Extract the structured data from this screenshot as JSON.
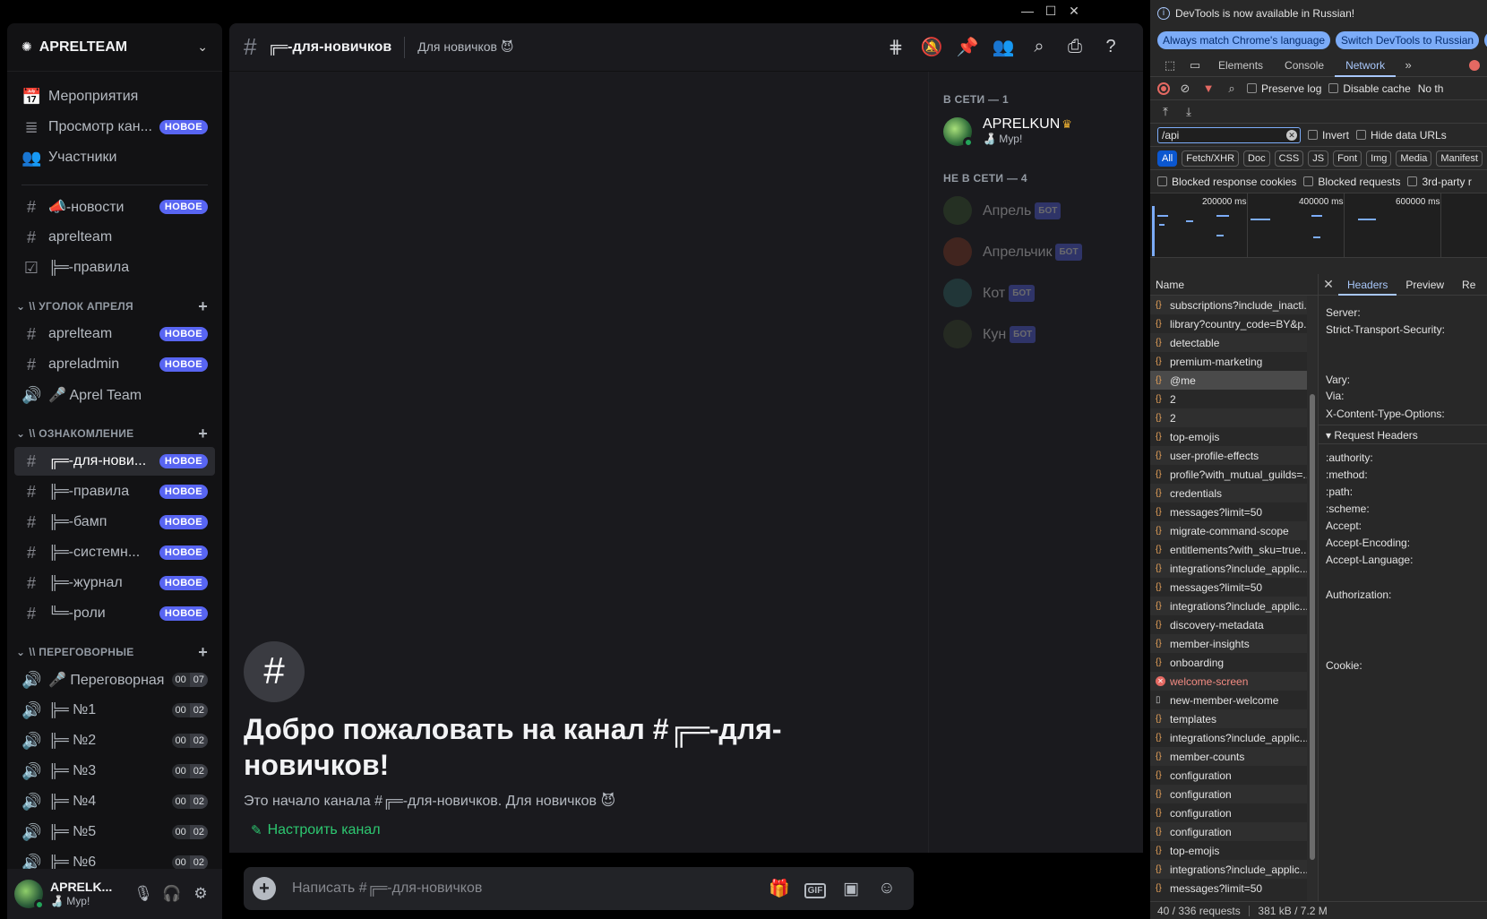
{
  "window": {
    "controls": [
      "—",
      "☐",
      "✕"
    ]
  },
  "guild": {
    "name": "APRELTEAM",
    "top_items": [
      {
        "icon": "📅",
        "icon_name": "calendar-icon",
        "label": "Мероприятия",
        "badge": ""
      },
      {
        "icon": "≣",
        "icon_name": "browse-channels-icon",
        "label": "Просмотр кан...",
        "badge": "НОВОЕ"
      },
      {
        "icon": "👥",
        "icon_name": "members-icon",
        "label": "Участники",
        "badge": ""
      }
    ],
    "channels_top": [
      {
        "icon": "#",
        "label": "📣-новости",
        "badge": "НОВОЕ"
      },
      {
        "icon": "#",
        "label": "aprelteam",
        "badge": ""
      },
      {
        "icon": "☑",
        "label": "╠═-правила",
        "badge": ""
      }
    ],
    "categories": [
      {
        "name": "\\\\ УГОЛОК АПРЕЛЯ",
        "channels": [
          {
            "icon": "#",
            "label": "aprelteam",
            "badge": "НОВОЕ",
            "voice": false
          },
          {
            "icon": "#",
            "label": "apreladmin",
            "badge": "НОВОЕ",
            "voice": false
          },
          {
            "icon": "🔊",
            "label": "🎤 Aprel Team",
            "badge": "",
            "voice": true
          }
        ]
      },
      {
        "name": "\\\\ ОЗНАКОМЛЕНИЕ",
        "channels": [
          {
            "icon": "#",
            "label": "╔═-для-нови...",
            "badge": "НОВОЕ",
            "active": true
          },
          {
            "icon": "#",
            "label": "╠═-правила",
            "badge": "НОВОЕ"
          },
          {
            "icon": "#",
            "label": "╠═-бамп",
            "badge": "НОВОЕ"
          },
          {
            "icon": "#",
            "label": "╠═-системн...",
            "badge": "НОВОЕ"
          },
          {
            "icon": "#",
            "label": "╠═-журнал",
            "badge": "НОВОЕ"
          },
          {
            "icon": "#",
            "label": "╚═-роли",
            "badge": "НОВОЕ"
          }
        ]
      },
      {
        "name": "\\\\ ПЕРЕГОВОРНЫЕ",
        "channels": [
          {
            "icon": "🔊",
            "label": "🎤 Переговорная",
            "count_a": "00",
            "count_b": "07"
          },
          {
            "icon": "🔊",
            "label": "╠═ №1",
            "count_a": "00",
            "count_b": "02"
          },
          {
            "icon": "🔊",
            "label": "╠═ №2",
            "count_a": "00",
            "count_b": "02"
          },
          {
            "icon": "🔊",
            "label": "╠═ №3",
            "count_a": "00",
            "count_b": "02"
          },
          {
            "icon": "🔊",
            "label": "╠═ №4",
            "count_a": "00",
            "count_b": "02"
          },
          {
            "icon": "🔊",
            "label": "╠═ №5",
            "count_a": "00",
            "count_b": "02"
          },
          {
            "icon": "🔊",
            "label": "╠═ №6",
            "count_a": "00",
            "count_b": "02"
          }
        ]
      }
    ]
  },
  "user_panel": {
    "name": "APRELK...",
    "status": "🍶 Мур!"
  },
  "channel_header": {
    "name": "╔═-для-новичков",
    "topic": "Для новичков 😈"
  },
  "members": {
    "online_title": "В СЕТИ — 1",
    "offline_title": "НЕ В СЕТИ — 4",
    "online": [
      {
        "name": "APRELKUN",
        "status": "🍶 Мур!",
        "owner": true,
        "avatar_color": "#4c8a3f"
      }
    ],
    "offline": [
      {
        "name": "Апрель",
        "tag": "БОТ",
        "avatar_color": "#3b5a2e"
      },
      {
        "name": "Апрельчик",
        "tag": "БОТ",
        "avatar_color": "#8a3a22"
      },
      {
        "name": "Кот",
        "tag": "БОТ",
        "avatar_color": "#2f6a6a"
      },
      {
        "name": "Кун",
        "tag": "БОТ",
        "avatar_color": "#3a4a2a"
      }
    ]
  },
  "welcome": {
    "title": "Добро пожаловать на канал #╔═-для-новичков!",
    "subtitle": "Это начало канала #╔═-для-новичков. Для новичков 😈",
    "setup_label": "Настроить канал"
  },
  "composer": {
    "placeholder": "Написать #╔═-для-новичков"
  },
  "devtools": {
    "info_text": "DevTools is now available in Russian!",
    "btn_match": "Always match Chrome's language",
    "btn_switch": "Switch DevTools to Russian",
    "btn_d": "D",
    "tabs": [
      "Elements",
      "Console",
      "Network"
    ],
    "preserve_log": "Preserve log",
    "disable_cache": "Disable cache",
    "throttle": "No th",
    "filter_value": "/api",
    "invert": "Invert",
    "hide_data_urls": "Hide data URLs",
    "types": [
      "All",
      "Fetch/XHR",
      "Doc",
      "CSS",
      "JS",
      "Font",
      "Img",
      "Media",
      "Manifest"
    ],
    "blocked_cookies": "Blocked response cookies",
    "blocked_requests": "Blocked requests",
    "third_party": "3rd-party r",
    "overview_labels": [
      "200000 ms",
      "400000 ms",
      "600000 ms"
    ],
    "name_header": "Name",
    "requests": [
      {
        "name": "subscriptions?include_inacti...",
        "kind": "xhr"
      },
      {
        "name": "library?country_code=BY&p...",
        "kind": "xhr"
      },
      {
        "name": "detectable",
        "kind": "xhr"
      },
      {
        "name": "premium-marketing",
        "kind": "xhr"
      },
      {
        "name": "@me",
        "kind": "xhr",
        "selected": true
      },
      {
        "name": "2",
        "kind": "xhr"
      },
      {
        "name": "2",
        "kind": "xhr"
      },
      {
        "name": "top-emojis",
        "kind": "xhr"
      },
      {
        "name": "user-profile-effects",
        "kind": "xhr"
      },
      {
        "name": "profile?with_mutual_guilds=...",
        "kind": "xhr"
      },
      {
        "name": "credentials",
        "kind": "xhr"
      },
      {
        "name": "messages?limit=50",
        "kind": "xhr"
      },
      {
        "name": "migrate-command-scope",
        "kind": "xhr"
      },
      {
        "name": "entitlements?with_sku=true...",
        "kind": "xhr"
      },
      {
        "name": "integrations?include_applic...",
        "kind": "xhr"
      },
      {
        "name": "messages?limit=50",
        "kind": "xhr"
      },
      {
        "name": "integrations?include_applic...",
        "kind": "xhr"
      },
      {
        "name": "discovery-metadata",
        "kind": "xhr"
      },
      {
        "name": "member-insights",
        "kind": "xhr"
      },
      {
        "name": "onboarding",
        "kind": "xhr"
      },
      {
        "name": "welcome-screen",
        "kind": "failed"
      },
      {
        "name": "new-member-welcome",
        "kind": "doc"
      },
      {
        "name": "templates",
        "kind": "xhr"
      },
      {
        "name": "integrations?include_applic...",
        "kind": "xhr"
      },
      {
        "name": "member-counts",
        "kind": "xhr"
      },
      {
        "name": "configuration",
        "kind": "xhr"
      },
      {
        "name": "configuration",
        "kind": "xhr"
      },
      {
        "name": "configuration",
        "kind": "xhr"
      },
      {
        "name": "configuration",
        "kind": "xhr"
      },
      {
        "name": "top-emojis",
        "kind": "xhr"
      },
      {
        "name": "integrations?include_applic...",
        "kind": "xhr"
      },
      {
        "name": "messages?limit=50",
        "kind": "xhr"
      }
    ],
    "detail_tabs": [
      "Headers",
      "Preview",
      "Re"
    ],
    "response_headers": [
      "Server:",
      "Strict-Transport-Security:",
      "Vary:",
      "Via:",
      "X-Content-Type-Options:"
    ],
    "request_headers_title": "Request Headers",
    "request_headers": [
      ":authority:",
      ":method:",
      ":path:",
      ":scheme:",
      "Accept:",
      "Accept-Encoding:",
      "Accept-Language:",
      "Authorization:",
      "Cookie:"
    ],
    "status_requests": "40 / 336 requests",
    "status_transfer": "381 kB / 7.2 M"
  }
}
